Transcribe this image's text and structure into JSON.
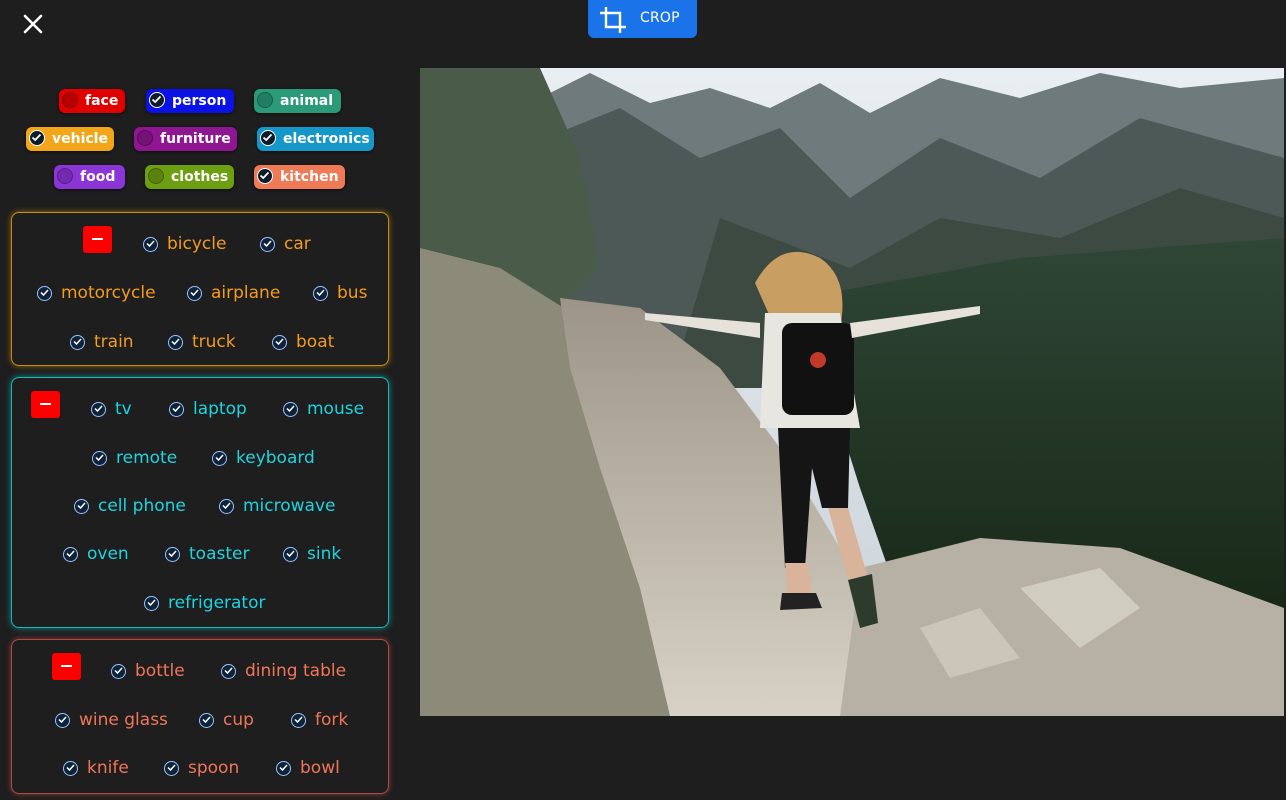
{
  "toolbar": {
    "crop_label": "CROP",
    "close_icon": "close-icon",
    "crop_icon": "crop-icon"
  },
  "categories": [
    {
      "label": "face",
      "color": "#e00000",
      "checked": false
    },
    {
      "label": "person",
      "color": "#0a12e6",
      "checked": true
    },
    {
      "label": "animal",
      "color": "#2a9a78",
      "checked": false
    },
    {
      "label": "vehicle",
      "color": "#f3a61a",
      "checked": true
    },
    {
      "label": "furniture",
      "color": "#8e1690",
      "checked": false
    },
    {
      "label": "electronics",
      "color": "#1597c9",
      "checked": true
    },
    {
      "label": "food",
      "color": "#8b35d6",
      "checked": false
    },
    {
      "label": "clothes",
      "color": "#6e9e12",
      "checked": false
    },
    {
      "label": "kitchen",
      "color": "#ef7a56",
      "checked": true
    }
  ],
  "groups": {
    "vehicle": {
      "color": "#f39c1f",
      "items": [
        "bicycle",
        "car",
        "motorcycle",
        "airplane",
        "bus",
        "train",
        "truck",
        "boat"
      ]
    },
    "electronics": {
      "color": "#1fd3e0",
      "items": [
        "tv",
        "laptop",
        "mouse",
        "remote",
        "keyboard",
        "cell phone",
        "microwave",
        "oven",
        "toaster",
        "sink",
        "refrigerator"
      ]
    },
    "kitchen": {
      "color": "#f0765a",
      "items": [
        "bottle",
        "dining table",
        "wine glass",
        "cup",
        "fork",
        "knife",
        "spoon",
        "bowl"
      ]
    }
  }
}
